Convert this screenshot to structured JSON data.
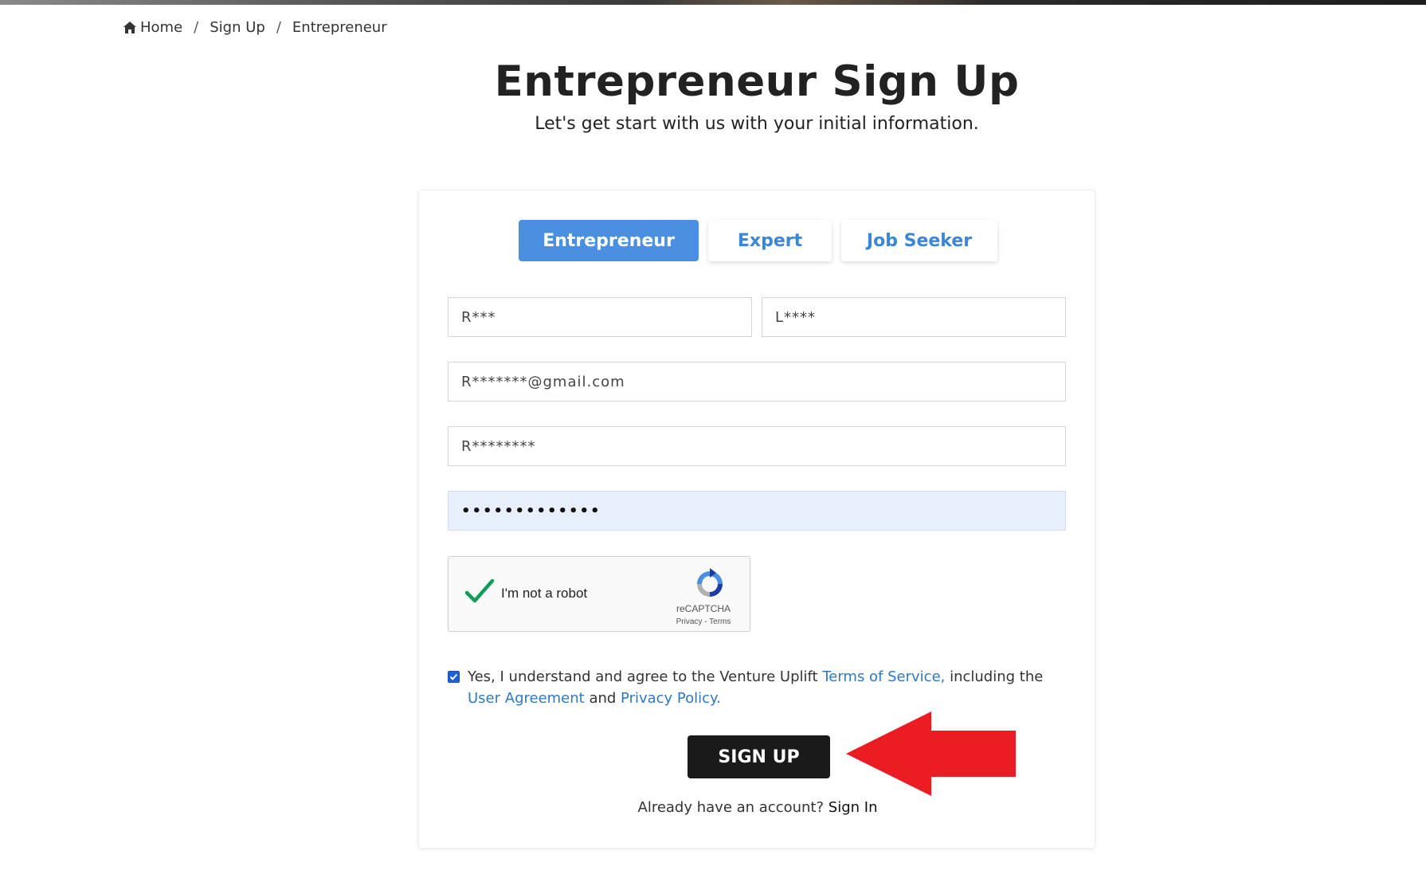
{
  "breadcrumb": {
    "home": "Home",
    "signup": "Sign Up",
    "current": "Entrepreneur",
    "separator": "/"
  },
  "header": {
    "title": "Entrepreneur Sign Up",
    "subtitle": "Let's get start with us with your initial information."
  },
  "tabs": [
    {
      "label": "Entrepreneur",
      "active": true
    },
    {
      "label": "Expert",
      "active": false
    },
    {
      "label": "Job Seeker",
      "active": false
    }
  ],
  "form": {
    "first_name": "R***",
    "last_name": "L****",
    "email": "R*******@gmail.com",
    "username": "R********",
    "password_masked": "•••••••••••••"
  },
  "recaptcha": {
    "label": "I'm not a robot",
    "brand": "reCAPTCHA",
    "links": "Privacy - Terms",
    "checked": true
  },
  "agreement": {
    "checked": true,
    "text_before": "Yes, I understand and agree to the Venture Uplift ",
    "terms_link": "Terms of Service,",
    "text_middle": " including the ",
    "user_agreement_link": "User Agreement",
    "text_and": " and ",
    "privacy_link": "Privacy Policy."
  },
  "signup_button": "SIGN UP",
  "signin": {
    "prompt": "Already have an account?",
    "link": "Sign In"
  },
  "colors": {
    "accent_blue": "#4a8fe0",
    "link_blue": "#2f78c4",
    "button_dark": "#1a1a1a",
    "annotation_arrow": "#ec1c24",
    "autofill_bg": "#e8f0fe"
  },
  "icons": [
    "home-icon",
    "recaptcha-checkmark-icon",
    "recaptcha-logo-icon",
    "checkbox-check-icon",
    "red-arrow-annotation"
  ]
}
